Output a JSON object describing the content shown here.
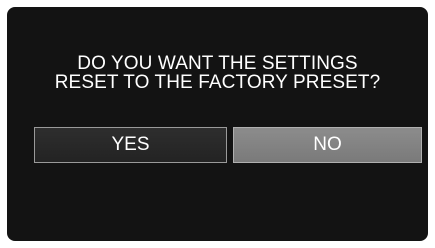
{
  "dialog": {
    "message_line1": "DO YOU WANT THE SETTINGS",
    "message_line2": "RESET TO THE FACTORY PRESET?",
    "yes_label": "YES",
    "no_label": "NO",
    "selected": "NO"
  },
  "colors": {
    "screen_background": "#131313",
    "text": "#ffffff",
    "button_unselected": "#2a2a2a",
    "button_selected": "#858585"
  }
}
